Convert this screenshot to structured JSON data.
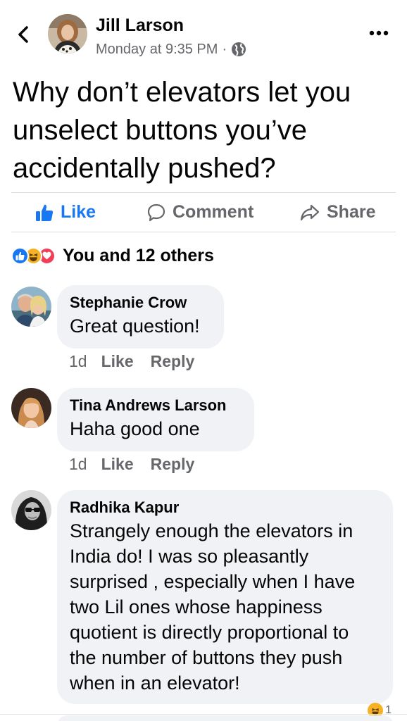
{
  "header": {
    "author_name": "Jill Larson",
    "timestamp": "Monday at 9:35 PM",
    "separator": "·",
    "privacy_icon": "globe-icon",
    "back_icon": "chevron-left-icon",
    "more_icon": "more-horizontal-icon"
  },
  "post": {
    "text": "Why don’t elevators let you unselect buttons you’ve accidentally pushed?"
  },
  "actions": {
    "like_label": "Like",
    "comment_label": "Comment",
    "share_label": "Share"
  },
  "reactions": {
    "icons": [
      "like-reaction-icon",
      "haha-reaction-icon",
      "love-reaction-icon"
    ],
    "summary": "You and 12 others"
  },
  "comments": [
    {
      "name": "Stephanie Crow",
      "text": "Great question!",
      "time": "1d",
      "like_label": "Like",
      "reply_label": "Reply"
    },
    {
      "name": "Tina Andrews Larson",
      "text": "Haha good one",
      "time": "1d",
      "like_label": "Like",
      "reply_label": "Reply"
    },
    {
      "name": "Radhika Kapur",
      "text": "Strangely enough the elevators in India do! I was so pleasantly surprised , especially when I have two Lil ones whose happiness quotient is directly proportional to the number of buttons they push when in an elevator!",
      "reaction_count": "1"
    }
  ],
  "colors": {
    "accent": "#1877f2",
    "secondary_text": "#65676b",
    "bubble_bg": "#f0f2f5",
    "love": "#f33e58",
    "haha": "#f7b125"
  }
}
